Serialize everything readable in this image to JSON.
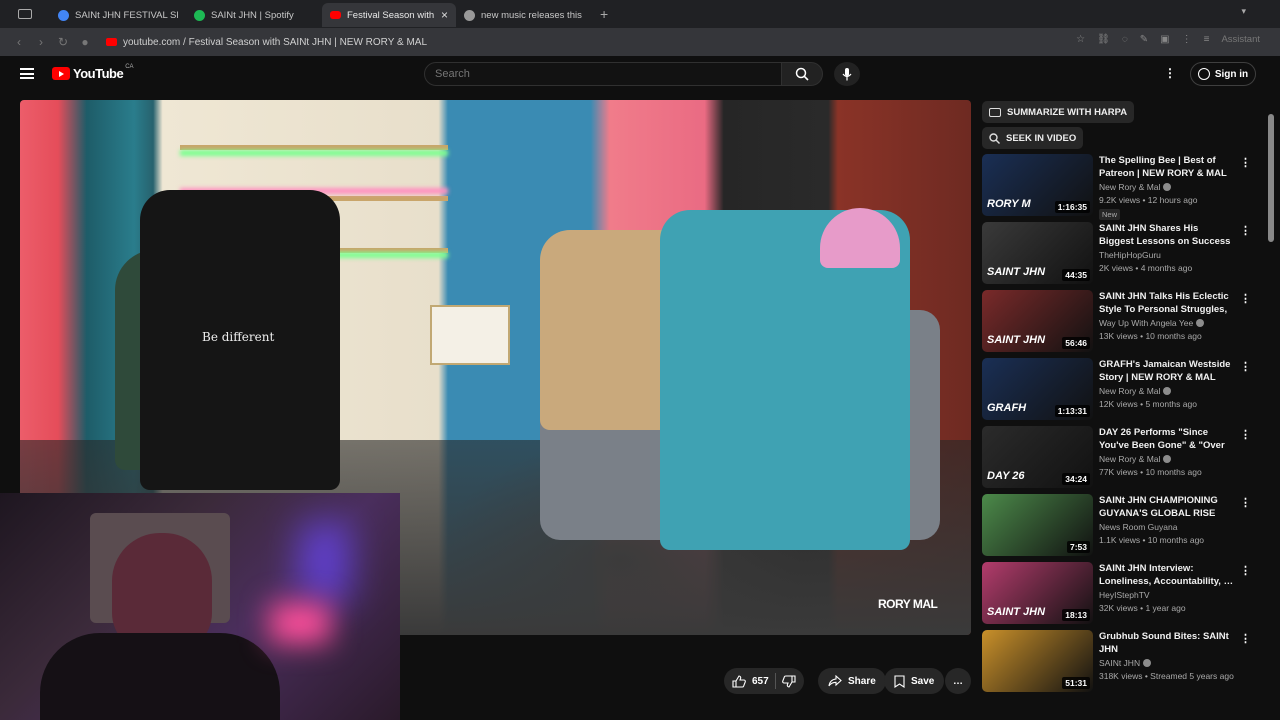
{
  "browser": {
    "tabs": [
      {
        "label": "SAINt JHN FESTIVAL SEASO",
        "color": "#4285f4"
      },
      {
        "label": "SAINt JHN | Spotify",
        "color": "#1db954"
      },
      {
        "label": "Festival Season with SAI",
        "color": "#ff0000",
        "active": true
      },
      {
        "label": "new music releases this wee",
        "color": "#cccccc"
      }
    ],
    "new_tab": "+",
    "close": "×",
    "url": "youtube.com / Festival Season with SAINt JHN | NEW RORY & MAL",
    "assistant": "Assistant"
  },
  "youtube": {
    "wordmark": "YouTube",
    "country": "CA",
    "search_placeholder": "Search",
    "signin": "Sign in",
    "menu_glyph": "⋮"
  },
  "video": {
    "watermark": "RORY MAL",
    "shirt_text": "Be different"
  },
  "actions": {
    "likes": "657",
    "share": "Share",
    "save": "Save",
    "more": "…"
  },
  "sidebar": {
    "summarize": "SUMMARIZE WITH HARPA",
    "seek": "SEEK IN VIDEO",
    "recommendations": [
      {
        "title": "The Spelling Bee | Best of Patreon | NEW RORY & MAL",
        "channel": "New Rory & Mal",
        "verified": true,
        "meta": "9.2K views • 12 hours ago",
        "badge": "New",
        "duration": "1:16:35",
        "thumb_color": "#1a2f55",
        "thumb_text": "RORY M"
      },
      {
        "title": "SAINt JHN Shares His Biggest Lessons on Success & …",
        "channel": "TheHipHopGuru",
        "verified": false,
        "meta": "2K views • 4 months ago",
        "badge": "",
        "duration": "44:35",
        "thumb_color": "#3a3a3a",
        "thumb_text": "SAINT JHN"
      },
      {
        "title": "SAINt JHN Talks His Eclectic Style To Personal Struggles, …",
        "channel": "Way Up With Angela Yee",
        "verified": true,
        "meta": "13K views • 10 months ago",
        "badge": "",
        "duration": "56:46",
        "thumb_color": "#7a2a2a",
        "thumb_text": "SAINT JHN"
      },
      {
        "title": "GRAFH's Jamaican Westside Story | NEW RORY & MAL",
        "channel": "New Rory & Mal",
        "verified": true,
        "meta": "12K views • 5 months ago",
        "badge": "",
        "duration": "1:13:31",
        "thumb_color": "#1a2f55",
        "thumb_text": "GRAFH"
      },
      {
        "title": "DAY 26 Performs \"Since You've Been Gone\" & \"Over You\" + …",
        "channel": "New Rory & Mal",
        "verified": true,
        "meta": "77K views • 10 months ago",
        "badge": "",
        "duration": "34:24",
        "thumb_color": "#2b2b2b",
        "thumb_text": "DAY 26"
      },
      {
        "title": "SAINt JHN CHAMPIONING GUYANA'S GLOBAL RISE",
        "channel": "News Room Guyana",
        "verified": false,
        "meta": "1.1K views • 10 months ago",
        "badge": "",
        "duration": "7:53",
        "thumb_color": "#4c8a4a",
        "thumb_text": ""
      },
      {
        "title": "SAINt JHN Interview: Loneliness, Accountability, …",
        "channel": "HeyIStephTV",
        "verified": false,
        "meta": "32K views • 1 year ago",
        "badge": "",
        "duration": "18:13",
        "thumb_color": "#b33c6c",
        "thumb_text": "SAINT JHN"
      },
      {
        "title": "Grubhub Sound Bites: SAINt JHN",
        "channel": "SAINt JHN",
        "verified": true,
        "meta": "318K views • Streamed 5 years ago",
        "badge": "",
        "duration": "51:31",
        "thumb_color": "#c9902a",
        "thumb_text": ""
      }
    ]
  }
}
